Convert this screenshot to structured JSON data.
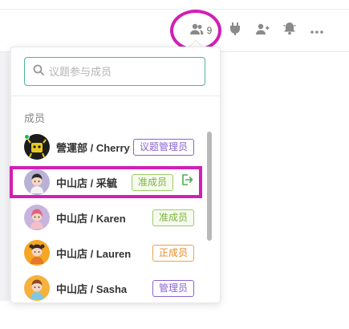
{
  "toolbar": {
    "member_count": "9",
    "icons": [
      "members-icon",
      "plugin-icon",
      "add-member-icon",
      "notification-icon",
      "more-icon"
    ]
  },
  "member_panel": {
    "search_placeholder": "议题参与成员",
    "section_label": "成员",
    "members": [
      {
        "name": "營運部 / Cherry",
        "role": "议题管理员",
        "online": true
      },
      {
        "name": "中山店 / 采毓",
        "role": "准成员"
      },
      {
        "name": "中山店 / Karen",
        "role": "准成员"
      },
      {
        "name": "中山店 / Lauren",
        "role": "正成员"
      },
      {
        "name": "中山店 / Sasha",
        "role": "管理员"
      }
    ]
  },
  "colors": {
    "highlight": "#d11fb6",
    "search_border": "#4fb39a",
    "online": "#24b35a",
    "role_purple": "#8a63d2",
    "role_green": "#7ab33c",
    "role_orange": "#e88c2a"
  }
}
